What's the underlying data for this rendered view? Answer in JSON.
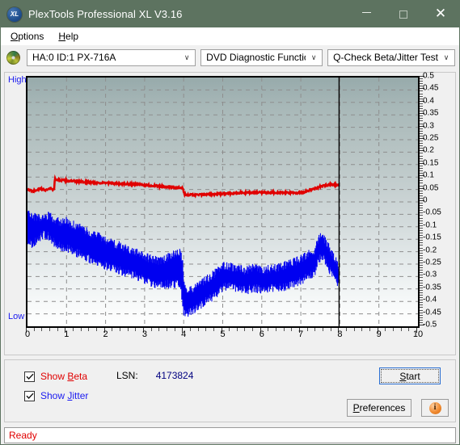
{
  "window": {
    "title": "PlexTools Professional XL V3.16",
    "icon": "app-xl-icon",
    "icon_text": "XL",
    "minimize_label": "–",
    "maximize_label": "□",
    "close_label": "✕",
    "titlebar_color": "#5d7360"
  },
  "menubar": {
    "items": [
      {
        "label": "Options",
        "accel": "O"
      },
      {
        "label": "Help",
        "accel": "H"
      }
    ]
  },
  "toolbar": {
    "drive_icon": "optical-disc-icon",
    "drive_select": {
      "value": "HA:0 ID:1  PX-716A",
      "options": [
        "HA:0 ID:1  PX-716A"
      ]
    },
    "function_select": {
      "value": "DVD Diagnostic Functions",
      "options": [
        "DVD Diagnostic Functions"
      ]
    },
    "test_select": {
      "value": "Q-Check Beta/Jitter Test",
      "options": [
        "Q-Check Beta/Jitter Test"
      ]
    },
    "arrow_glyph": "∨"
  },
  "chart_labels": {
    "high": "High",
    "low": "Low"
  },
  "controls": {
    "show_beta": {
      "label_pre": "Show ",
      "label_accel": "B",
      "label_post": "eta",
      "checked": true,
      "color": "#e00000"
    },
    "show_jitter": {
      "label_pre": "Show ",
      "label_accel": "J",
      "label_post": "itter",
      "checked": true,
      "color": "#1a1af0"
    },
    "lsn_caption": "LSN:",
    "lsn_value": "4173824",
    "start_button": {
      "pre": "",
      "accel": "S",
      "post": "tart"
    },
    "preferences_button": {
      "pre": "",
      "accel": "P",
      "post": "references"
    },
    "info_button": {
      "label": "i",
      "name": "info-icon"
    }
  },
  "statusbar": {
    "text": "Ready"
  },
  "chart_data": {
    "type": "line",
    "title": "Q-Check Beta/Jitter Test",
    "xlabel": "",
    "ylabel": "",
    "xlim": [
      0,
      10
    ],
    "ylim": [
      -0.5,
      0.5
    ],
    "grid": true,
    "legend_position": "bottom-left",
    "x_ticks": [
      0,
      1,
      2,
      3,
      4,
      5,
      6,
      7,
      8,
      9,
      10
    ],
    "x_minor_step": 0.2,
    "y_ticks": [
      0.5,
      0.45,
      0.4,
      0.35,
      0.3,
      0.25,
      0.2,
      0.15,
      0.1,
      0.05,
      0,
      -0.05,
      -0.1,
      -0.15,
      -0.2,
      -0.25,
      -0.3,
      -0.35,
      -0.4,
      -0.45,
      -0.5
    ],
    "y_tick_labels": [
      "0.5",
      "0.45",
      "0.4",
      "0.35",
      "0.3",
      "0.25",
      "0.2",
      "0.15",
      "0.1",
      "0.05",
      "0",
      "-0.05",
      "-0.1",
      "-0.15",
      "-0.2",
      "-0.25",
      "-0.3",
      "-0.35",
      "-0.4",
      "-0.45",
      "-0.5"
    ],
    "data_end_marker_x": 7.98,
    "series": [
      {
        "name": "Beta",
        "color": "#e00000",
        "band": false,
        "x": [
          0.02,
          0.15,
          0.3,
          0.45,
          0.6,
          0.68,
          0.7,
          0.8,
          0.95,
          1.2,
          1.5,
          1.8,
          2.1,
          2.4,
          2.7,
          3.0,
          3.3,
          3.6,
          3.9,
          3.98,
          4.02,
          4.2,
          4.5,
          4.8,
          5.1,
          5.4,
          5.7,
          6.0,
          6.3,
          6.6,
          6.9,
          7.05,
          7.2,
          7.4,
          7.6,
          7.75,
          7.9,
          7.97
        ],
        "y": [
          0.048,
          0.044,
          0.052,
          0.048,
          0.055,
          0.047,
          0.092,
          0.088,
          0.086,
          0.083,
          0.08,
          0.077,
          0.075,
          0.073,
          0.071,
          0.068,
          0.064,
          0.06,
          0.056,
          0.054,
          0.03,
          0.028,
          0.029,
          0.031,
          0.034,
          0.036,
          0.037,
          0.038,
          0.038,
          0.037,
          0.036,
          0.038,
          0.046,
          0.056,
          0.066,
          0.071,
          0.069,
          0.07
        ],
        "noise": 0.004
      },
      {
        "name": "Jitter",
        "color": "#0000f0",
        "band": true,
        "x": [
          0.02,
          0.12,
          0.25,
          0.4,
          0.55,
          0.7,
          0.85,
          1.0,
          1.2,
          1.4,
          1.6,
          1.9,
          2.2,
          2.5,
          2.8,
          3.1,
          3.4,
          3.7,
          3.9,
          3.97,
          4.0,
          4.05,
          4.15,
          4.3,
          4.5,
          4.7,
          4.9,
          5.05,
          5.2,
          5.4,
          5.6,
          5.8,
          6.0,
          6.2,
          6.4,
          6.6,
          6.8,
          7.0,
          7.2,
          7.35,
          7.45,
          7.55,
          7.65,
          7.75,
          7.85,
          7.93,
          7.97
        ],
        "y_top": [
          -0.052,
          -0.055,
          -0.065,
          -0.055,
          -0.058,
          -0.072,
          -0.082,
          -0.078,
          -0.095,
          -0.11,
          -0.125,
          -0.145,
          -0.165,
          -0.185,
          -0.205,
          -0.225,
          -0.24,
          -0.215,
          -0.205,
          -0.23,
          -0.33,
          -0.35,
          -0.36,
          -0.34,
          -0.32,
          -0.3,
          -0.275,
          -0.255,
          -0.26,
          -0.27,
          -0.275,
          -0.265,
          -0.275,
          -0.27,
          -0.265,
          -0.255,
          -0.245,
          -0.225,
          -0.21,
          -0.195,
          -0.15,
          -0.135,
          -0.16,
          -0.195,
          -0.225,
          -0.25,
          -0.285
        ],
        "y_bot": [
          -0.165,
          -0.17,
          -0.155,
          -0.13,
          -0.14,
          -0.165,
          -0.18,
          -0.185,
          -0.2,
          -0.215,
          -0.23,
          -0.25,
          -0.265,
          -0.285,
          -0.3,
          -0.32,
          -0.335,
          -0.33,
          -0.33,
          -0.395,
          -0.44,
          -0.45,
          -0.445,
          -0.43,
          -0.405,
          -0.385,
          -0.365,
          -0.34,
          -0.34,
          -0.35,
          -0.355,
          -0.345,
          -0.355,
          -0.35,
          -0.345,
          -0.34,
          -0.33,
          -0.315,
          -0.3,
          -0.285,
          -0.235,
          -0.215,
          -0.245,
          -0.28,
          -0.3,
          -0.32,
          -0.33
        ],
        "noise": 0.018
      }
    ]
  }
}
